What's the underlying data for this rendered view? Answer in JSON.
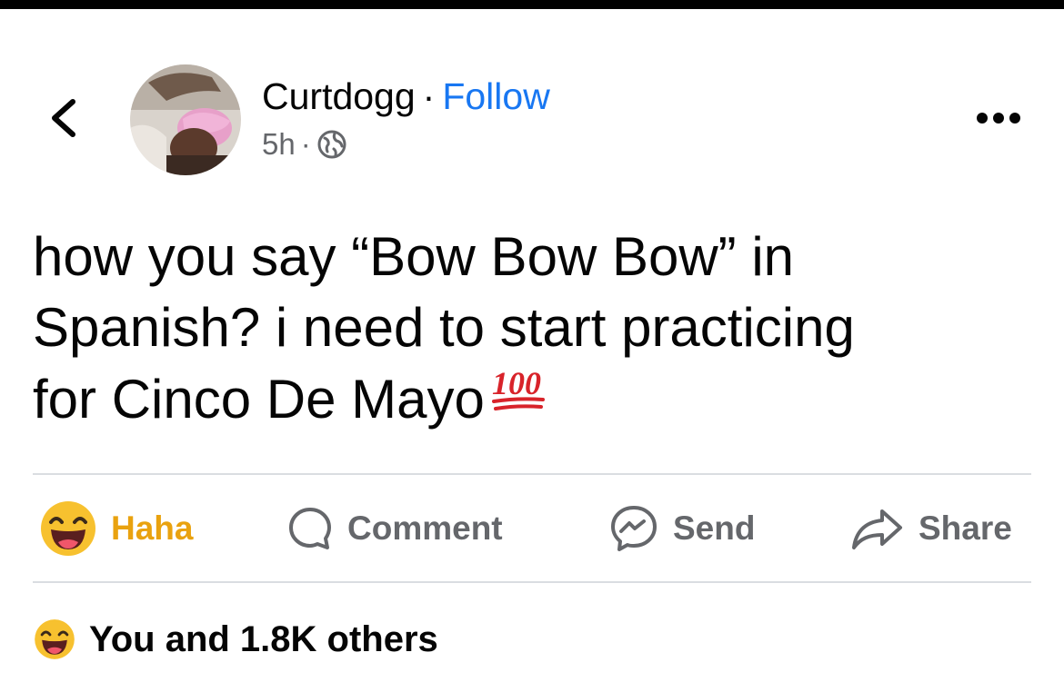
{
  "post": {
    "author": "Curtdogg",
    "separator": "·",
    "follow_label": "Follow",
    "time": "5h",
    "meta_dot": "·",
    "audience_icon": "globe-icon",
    "text_line1": "how you say “Bow Bow Bow” in",
    "text_line2": "Spanish? i need to start practicing",
    "text_line3": "for Cinco De Mayo",
    "emoji": "hundred-points-emoji"
  },
  "actions": {
    "haha_label": "Haha",
    "comment_label": "Comment",
    "send_label": "Send",
    "share_label": "Share"
  },
  "reactions": {
    "summary": "You and 1.8K others"
  },
  "colors": {
    "follow": "#1877f2",
    "haha": "#e9a20f",
    "muted": "#65676b",
    "text": "#050505"
  }
}
